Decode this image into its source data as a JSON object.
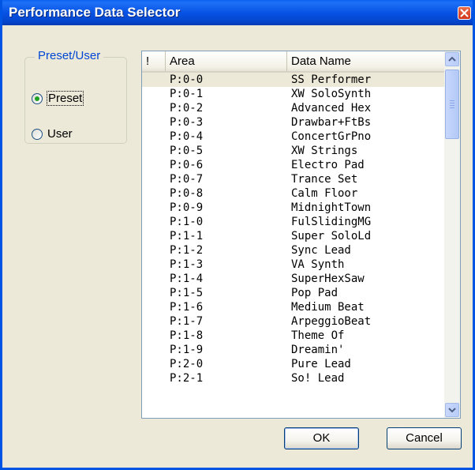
{
  "window": {
    "title": "Performance Data Selector"
  },
  "group": {
    "legend": "Preset/User",
    "options": [
      {
        "label": "Preset",
        "checked": true
      },
      {
        "label": "User",
        "checked": false
      }
    ]
  },
  "list": {
    "columns": [
      "!",
      "Area",
      "Data Name"
    ],
    "rows": [
      {
        "area": "P:0-0",
        "name": "SS Performer",
        "selected": true
      },
      {
        "area": "P:0-1",
        "name": "XW SoloSynth"
      },
      {
        "area": "P:0-2",
        "name": "Advanced Hex"
      },
      {
        "area": "P:0-3",
        "name": "Drawbar+FtBs"
      },
      {
        "area": "P:0-4",
        "name": "ConcertGrPno"
      },
      {
        "area": "P:0-5",
        "name": "XW Strings"
      },
      {
        "area": "P:0-6",
        "name": "Electro Pad"
      },
      {
        "area": "P:0-7",
        "name": "Trance Set"
      },
      {
        "area": "P:0-8",
        "name": "Calm Floor"
      },
      {
        "area": "P:0-9",
        "name": "MidnightTown"
      },
      {
        "area": "P:1-0",
        "name": "FulSlidingMG"
      },
      {
        "area": "P:1-1",
        "name": "Super SoloLd"
      },
      {
        "area": "P:1-2",
        "name": "Sync Lead"
      },
      {
        "area": "P:1-3",
        "name": "VA Synth"
      },
      {
        "area": "P:1-4",
        "name": "SuperHexSaw"
      },
      {
        "area": "P:1-5",
        "name": "Pop Pad"
      },
      {
        "area": "P:1-6",
        "name": "Medium Beat"
      },
      {
        "area": "P:1-7",
        "name": "ArpeggioBeat"
      },
      {
        "area": "P:1-8",
        "name": "Theme Of"
      },
      {
        "area": "P:1-9",
        "name": "Dreamin'"
      },
      {
        "area": "P:2-0",
        "name": "Pure Lead"
      },
      {
        "area": "P:2-1",
        "name": "So! Lead"
      }
    ]
  },
  "buttons": {
    "ok": "OK",
    "cancel": "Cancel"
  }
}
